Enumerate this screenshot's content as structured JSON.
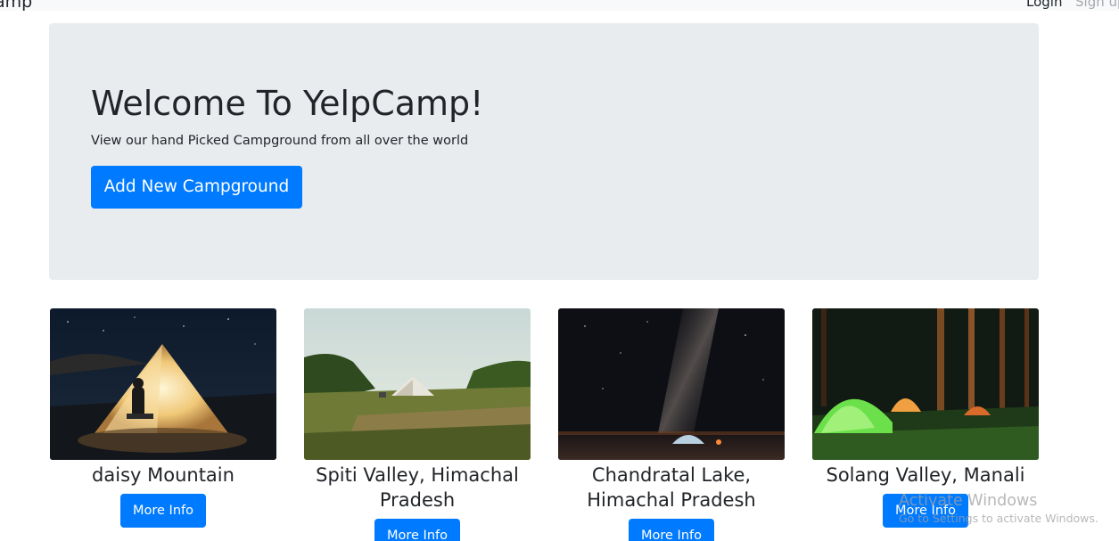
{
  "navbar": {
    "brand": "amp",
    "login": "Login",
    "signup": "Sign up"
  },
  "jumbotron": {
    "title": "Welcome To YelpCamp!",
    "lead": "View our hand Picked Campground from all over the world",
    "add_button": "Add New Campground"
  },
  "campgrounds": [
    {
      "name": "daisy Mountain",
      "button": "More Info"
    },
    {
      "name": "Spiti Valley, Himachal Pradesh",
      "button": "More Info"
    },
    {
      "name": "Chandratal Lake, Himachal Pradesh",
      "button": "More Info"
    },
    {
      "name": "Solang Valley, Manali",
      "button": "More Info"
    }
  ],
  "watermark": {
    "title": "Activate Windows",
    "subtitle": "Go to Settings to activate Windows."
  },
  "colors": {
    "primary": "#007bff",
    "jumbotron_bg": "#e9ecef",
    "navbar_bg": "#f8f9fa"
  }
}
